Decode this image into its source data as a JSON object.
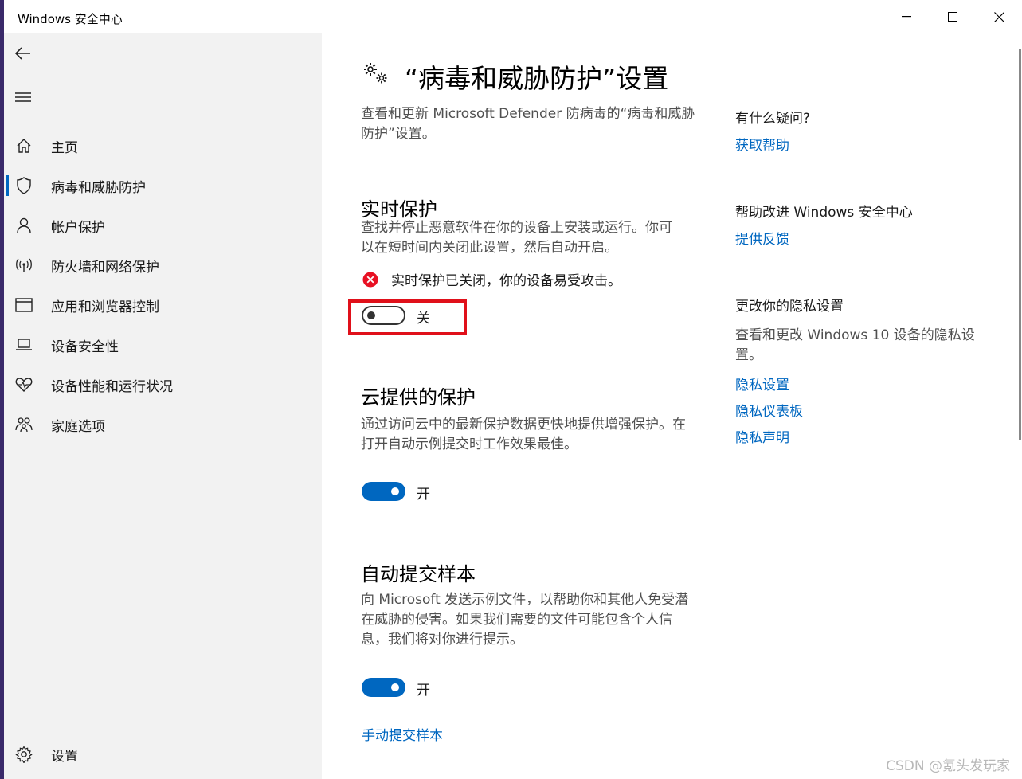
{
  "window": {
    "title": "Windows 安全中心"
  },
  "sidebar": {
    "items": [
      {
        "label": "主页",
        "icon": "home-icon"
      },
      {
        "label": "病毒和威胁防护",
        "icon": "shield-icon"
      },
      {
        "label": "帐户保护",
        "icon": "person-icon"
      },
      {
        "label": "防火墙和网络保护",
        "icon": "wifi-icon"
      },
      {
        "label": "应用和浏览器控制",
        "icon": "app-window-icon"
      },
      {
        "label": "设备安全性",
        "icon": "laptop-icon"
      },
      {
        "label": "设备性能和运行状况",
        "icon": "heart-icon"
      },
      {
        "label": "家庭选项",
        "icon": "family-icon"
      }
    ],
    "settings_label": "设置"
  },
  "main": {
    "title": "“病毒和威胁防护”设置",
    "description": "查看和更新 Microsoft Defender 防病毒的“病毒和威胁防护”设置。",
    "realtime": {
      "title": "实时保护",
      "description": "查找并停止恶意软件在你的设备上安装或运行。你可以在短时间内关闭此设置，然后自动开启。",
      "warning": "实时保护已关闭，你的设备易受攻击。",
      "toggle_label": "关",
      "toggle_state": "off"
    },
    "cloud": {
      "title": "云提供的保护",
      "description": "通过访问云中的最新保护数据更快地提供增强保护。在打开自动示例提交时工作效果最佳。",
      "toggle_label": "开",
      "toggle_state": "on"
    },
    "sample": {
      "title": "自动提交样本",
      "description": "向 Microsoft 发送示例文件，以帮助你和其他人免受潜在威胁的侵害。如果我们需要的文件可能包含个人信息，我们将对你进行提示。",
      "toggle_label": "开",
      "toggle_state": "on",
      "manual_link": "手动提交样本"
    }
  },
  "aside": {
    "question_heading": "有什么疑问?",
    "get_help": "获取帮助",
    "improve_heading": "帮助改进 Windows 安全中心",
    "feedback": "提供反馈",
    "privacy_heading": "更改你的隐私设置",
    "privacy_desc": "查看和更改 Windows 10 设备的隐私设置。",
    "privacy_settings": "隐私设置",
    "privacy_dashboard": "隐私仪表板",
    "privacy_statement": "隐私声明"
  },
  "watermark": "CSDN @氪头发玩家",
  "colors": {
    "accent": "#0067c0",
    "highlight_box": "#e0101a",
    "error": "#e81123"
  }
}
